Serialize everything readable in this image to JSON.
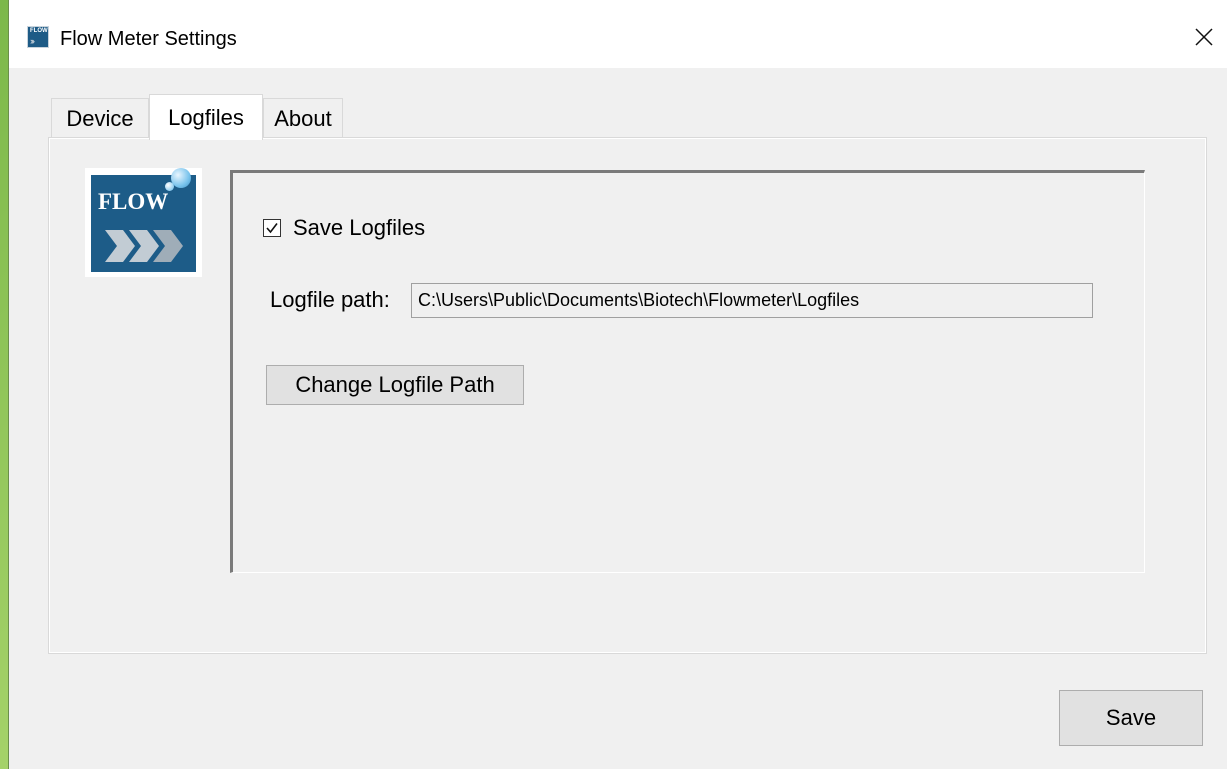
{
  "window": {
    "title": "Flow Meter Settings",
    "icon": "flow-app-icon"
  },
  "tabs": [
    {
      "label": "Device",
      "selected": false
    },
    {
      "label": "Logfiles",
      "selected": true
    },
    {
      "label": "About",
      "selected": false
    }
  ],
  "logo": {
    "wordmark": "FLOW",
    "colors": {
      "background": "#1d5c88",
      "chevrons": "#c2ccd4",
      "bubble": "#79c3ec"
    }
  },
  "logfiles": {
    "save_checkbox_label": "Save Logfiles",
    "save_checkbox_checked": true,
    "path_label": "Logfile path:",
    "path_value": "C:\\Users\\Public\\Documents\\Biotech\\Flowmeter\\Logfiles",
    "change_path_button": "Change Logfile Path"
  },
  "footer": {
    "save_button": "Save"
  },
  "icons": {
    "close": "close-icon",
    "check": "checkmark-icon"
  }
}
